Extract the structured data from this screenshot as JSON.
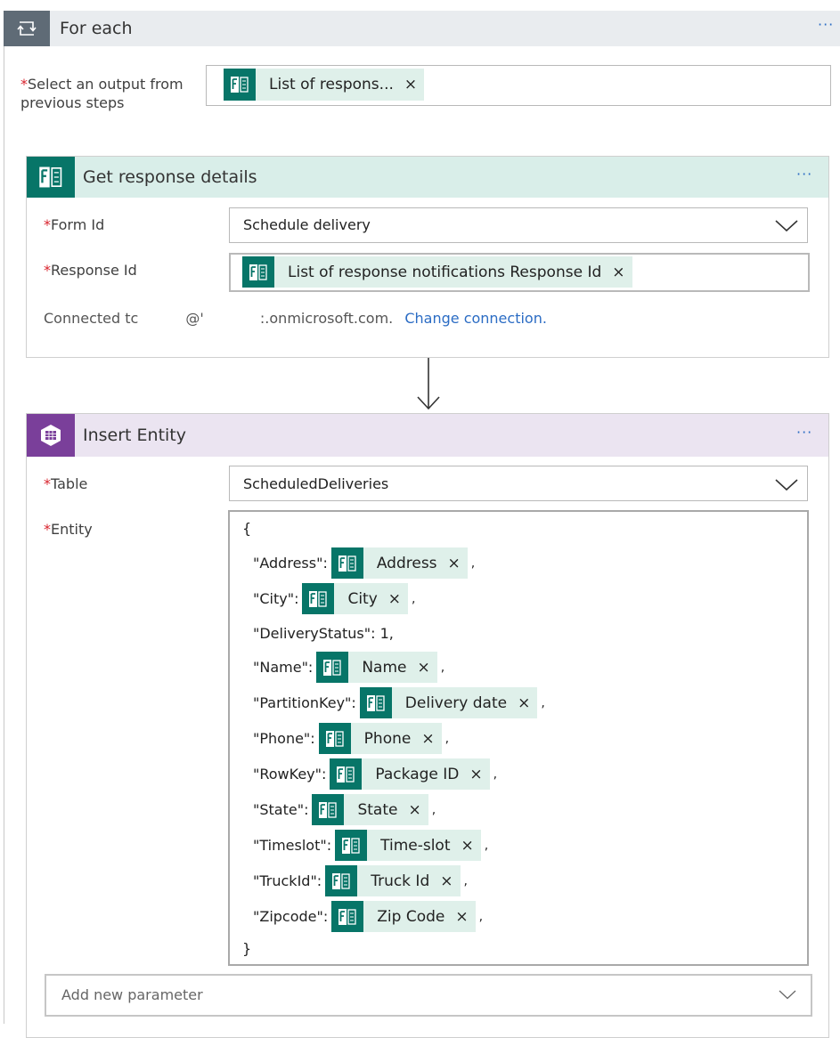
{
  "foreach": {
    "title": "For each",
    "menu": "···",
    "select_label": "Select an output from previous steps",
    "select_label_line1": "Select an output from",
    "select_label_line2": "previous steps",
    "selected_token": "List of respons...",
    "required_mark": "*"
  },
  "get_response": {
    "title": "Get response details",
    "menu": "···",
    "form_id_label": "Form Id",
    "form_id_value": "Schedule delivery",
    "response_id_label": "Response Id",
    "response_id_token": "List of response notifications Response Id",
    "connected_prefix": "Connected tc",
    "connected_at": "@'",
    "connected_domain": ":.onmicrosoft.com.",
    "change_connection": "Change connection."
  },
  "insert_entity": {
    "title": "Insert Entity",
    "menu": "···",
    "table_label": "Table",
    "table_value": "ScheduledDeliveries",
    "entity_label": "Entity",
    "open_brace": "{",
    "close_brace": "}",
    "fields": [
      {
        "key": "\"Address\":",
        "token": "Address"
      },
      {
        "key": "\"City\":",
        "token": "City"
      },
      {
        "key": "\"DeliveryStatus\": 1,",
        "token": ""
      },
      {
        "key": "\"Name\":",
        "token": "Name"
      },
      {
        "key": "\"PartitionKey\":",
        "token": "Delivery date"
      },
      {
        "key": "\"Phone\":",
        "token": "Phone"
      },
      {
        "key": "\"RowKey\":",
        "token": "Package ID"
      },
      {
        "key": "\"State\":",
        "token": "State"
      },
      {
        "key": "\"Timeslot\":",
        "token": "Time-slot"
      },
      {
        "key": "\"TruckId\":",
        "token": "Truck Id"
      },
      {
        "key": "\"Zipcode\":",
        "token": "Zip Code"
      }
    ],
    "add_param_placeholder": "Add new parameter"
  },
  "token_close": "×",
  "token_comma": ",",
  "colors": {
    "forms_green": "#077568",
    "token_bg": "#dff0ea",
    "forms_header_bg": "#d9eee9",
    "storage_header_bg": "#ebe4f1",
    "storage_purple": "#7a3f9a",
    "link_blue": "#2b6cc4",
    "required_red": "#d9232d"
  }
}
